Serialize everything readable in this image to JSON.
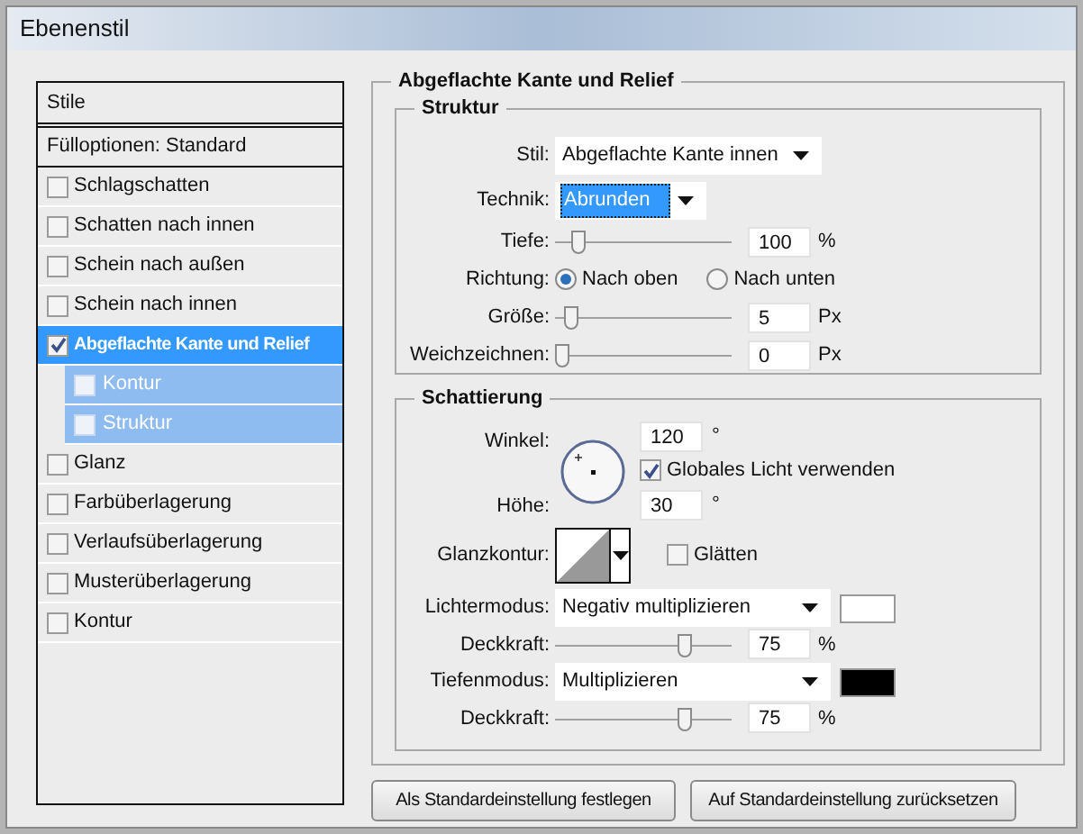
{
  "window": {
    "title": "Ebenenstil"
  },
  "styles": [
    {
      "kind": "header",
      "label": "Stile"
    },
    {
      "kind": "option",
      "label": "Fülloptionen: Standard"
    },
    {
      "kind": "effect",
      "label": "Schlagschatten",
      "checked": false,
      "selected": false
    },
    {
      "kind": "effect",
      "label": "Schatten nach innen",
      "checked": false,
      "selected": false
    },
    {
      "kind": "effect",
      "label": "Schein nach außen",
      "checked": false,
      "selected": false
    },
    {
      "kind": "effect",
      "label": "Schein nach innen",
      "checked": false,
      "selected": false
    },
    {
      "kind": "effect",
      "label": "Abgeflachte Kante und Relief",
      "checked": true,
      "selected": true,
      "children": [
        {
          "label": "Kontur",
          "checked": false
        },
        {
          "label": "Struktur",
          "checked": false
        }
      ]
    },
    {
      "kind": "effect",
      "label": "Glanz",
      "checked": false,
      "selected": false
    },
    {
      "kind": "effect",
      "label": "Farbüberlagerung",
      "checked": false,
      "selected": false
    },
    {
      "kind": "effect",
      "label": "Verlaufsüberlagerung",
      "checked": false,
      "selected": false
    },
    {
      "kind": "effect",
      "label": "Musterüberlagerung",
      "checked": false,
      "selected": false
    },
    {
      "kind": "effect",
      "label": "Kontur",
      "checked": false,
      "selected": false
    }
  ],
  "panel": {
    "title": "Abgeflachte Kante und Relief",
    "structure": {
      "title": "Struktur",
      "fields": [
        {
          "kind": "select",
          "label": "Stil:",
          "value": "Abgeflachte Kante innen",
          "focused": false
        },
        {
          "kind": "select",
          "label": "Technik:",
          "value": "Abrunden",
          "focused": true
        },
        {
          "kind": "slider",
          "label": "Tiefe:",
          "level": 0.1,
          "value": "100",
          "unit": "%"
        },
        {
          "kind": "radio",
          "label": "Richtung:",
          "options": [
            {
              "label": "Nach oben",
              "selected": true
            },
            {
              "label": "Nach unten",
              "selected": false
            }
          ]
        },
        {
          "kind": "slider",
          "label": "Größe:",
          "level": 0.05,
          "value": "5",
          "unit": "Px"
        },
        {
          "kind": "slider",
          "label": "Weichzeichnen:",
          "level": 0,
          "value": "0",
          "unit": "Px"
        }
      ]
    },
    "shading": {
      "title": "Schattierung",
      "angle": {
        "label": "Winkel:",
        "value": "120",
        "unit": "°"
      },
      "global_light": {
        "label": "Globales Licht verwenden",
        "checked": true
      },
      "altitude": {
        "label": "Höhe:",
        "value": "30",
        "unit": "°"
      },
      "gloss_contour": {
        "label": "Glanzkontur:"
      },
      "anti_alias": {
        "label": "Glätten",
        "checked": false
      },
      "fields": [
        {
          "kind": "select",
          "label": "Lichtermodus:",
          "value": "Negativ multiplizieren",
          "color": "#ffffff"
        },
        {
          "kind": "slider",
          "label": "Deckkraft:",
          "level": 0.75,
          "value": "75",
          "unit": "%"
        },
        {
          "kind": "select",
          "label": "Tiefenmodus:",
          "value": "Multiplizieren",
          "color": "#000000"
        },
        {
          "kind": "slider",
          "label": "Deckkraft:",
          "level": 0.75,
          "value": "75",
          "unit": "%"
        }
      ]
    }
  },
  "buttons": [
    "Als Standardeinstellung festlegen",
    "Auf Standardeinstellung zurücksetzen"
  ]
}
